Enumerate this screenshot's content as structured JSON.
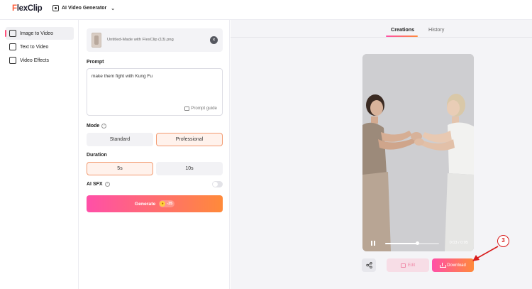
{
  "app": {
    "logo_text": "FlexClip",
    "logo_first": "F",
    "logo_rest": "lexClip",
    "tool_name": "AI Video Generator"
  },
  "sidebar": {
    "items": [
      {
        "label": "Image to Video",
        "active": true
      },
      {
        "label": "Text to Video",
        "active": false
      },
      {
        "label": "Video Effects",
        "active": false
      }
    ]
  },
  "panel": {
    "file_name": "Untitled-Made with FlexClip (13).png",
    "prompt_label": "Prompt",
    "prompt_value": "make them fight with Kung Fu",
    "prompt_guide": "Prompt guide",
    "mode_label": "Mode",
    "mode_options": [
      "Standard",
      "Professional"
    ],
    "mode_selected": "Professional",
    "duration_label": "Duration",
    "duration_options": [
      "5s",
      "10s"
    ],
    "duration_selected": "5s",
    "sfx_label": "AI SFX",
    "sfx_enabled": false,
    "generate_label": "Generate",
    "generate_cost": "-35"
  },
  "main": {
    "tabs": [
      {
        "label": "Creations",
        "active": true
      },
      {
        "label": "History",
        "active": false
      }
    ],
    "player": {
      "time": "0:03 / 0:05",
      "progress": 0.6
    },
    "edit_label": "Edit",
    "download_label": "Download",
    "step_number": "3"
  },
  "colors": {
    "accent_start": "#ff4fa8",
    "accent_end": "#ff8a3a",
    "annotation": "#d81c1c"
  }
}
